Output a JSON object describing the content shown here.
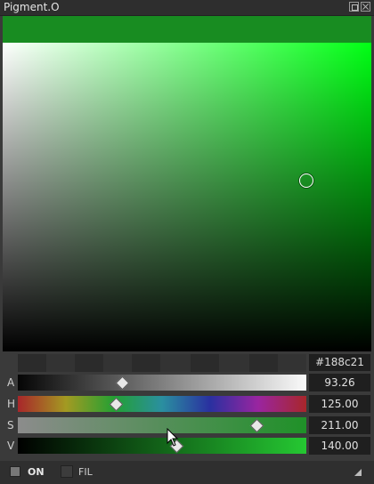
{
  "window": {
    "title": "Pigment.O"
  },
  "colors": {
    "current": "#188c21",
    "hue_color": "#00ff14",
    "panel_bg": "#3a3a3a"
  },
  "hex": {
    "value": "#188c21"
  },
  "sliders": [
    {
      "label": "A",
      "value": "93.26",
      "level": 0.36
    },
    {
      "label": "H",
      "value": "125.00",
      "level": 0.34
    },
    {
      "label": "S",
      "value": "211.00",
      "level": 0.827
    },
    {
      "label": "V",
      "value": "140.00",
      "level": 0.549
    }
  ],
  "bottom_bar": {
    "on_label": "ON",
    "fil_label": "FIL"
  },
  "icons": {
    "float": "float-icon",
    "close": "close-icon",
    "resize": "resize-grip-icon",
    "cursor": "mouse-pointer-icon"
  }
}
